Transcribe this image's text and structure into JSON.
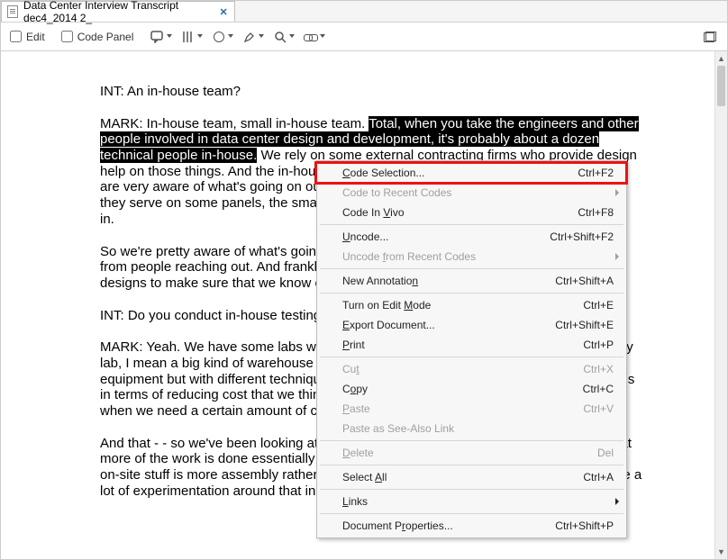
{
  "tab": {
    "title": "Data Center Interview Transcript dec4_2014 2_"
  },
  "toolbar": {
    "edit": "Edit",
    "code_panel": "Code Panel"
  },
  "doc": {
    "int1": "INT:   An in-house team?",
    "mark1_plain1": "MARK:  In-house team, small in-house team.  ",
    "mark1_hl": "Total, when you take the engineers and other people involved in data center design and development, it's probably about a dozen technical people in-house.",
    "mark1_plain2": "  We rely on some external contracting firms who provide design help on those things.  And the in-house team has a lot of input.  I think our technical folks are very aware of what's going on out there.  They attend a lot of the major conferences, they serve on some panels, the smaller vendors reach out to us regularly trying to break in.",
    "para2": "So we're pretty aware of what's going on and what's emerging, both from conferences, from people reaching out.  And frankly from the contract vendors we use to support our designs to make sure that we know of things we ought to be looking at.",
    "int2": "INT:   Do you conduct in-house testing?",
    "mark2a": "MARK:  Yeah.  We have some labs where we do a lot of testing on new things.  When I say lab, I mean a big kind of warehouse where you can experiment with not just a rack of equipment but with different techniques for constructing the data center.  One of the things in terms of reducing cost that we think about a lot is how can we reduce the time from when we need a certain amount of capacity to when we have it online?",
    "mark2b": "And that - - so we've been looking at a lot of manufacturing techniques, if you will, so that more of the work is done essentially in a manufacturing context in a factory and that the on-site stuff is more assembly rather than kind of stick-built construction.  And we've done a lot of experimentation around that in our labs."
  },
  "menu": {
    "code_selection": "Code Selection...",
    "code_selection_sc": "Ctrl+F2",
    "code_recent": "Code to Recent Codes",
    "code_invivo": "Code In Vivo",
    "code_invivo_sc": "Ctrl+F8",
    "uncode": "Uncode...",
    "uncode_sc": "Ctrl+Shift+F2",
    "uncode_recent": "Uncode from Recent Codes",
    "new_annotation": "New Annotation",
    "new_annotation_sc": "Ctrl+Shift+A",
    "edit_mode": "Turn on Edit Mode",
    "edit_mode_sc": "Ctrl+E",
    "export_doc": "Export Document...",
    "export_doc_sc": "Ctrl+Shift+E",
    "print": "Print",
    "print_sc": "Ctrl+P",
    "cut": "Cut",
    "cut_sc": "Ctrl+X",
    "copy": "Copy",
    "copy_sc": "Ctrl+C",
    "paste": "Paste",
    "paste_sc": "Ctrl+V",
    "paste_see_also": "Paste as See-Also Link",
    "delete": "Delete",
    "delete_sc": "Del",
    "select_all": "Select All",
    "select_all_sc": "Ctrl+A",
    "links": "Links",
    "doc_props": "Document Properties...",
    "doc_props_sc": "Ctrl+Shift+P"
  }
}
